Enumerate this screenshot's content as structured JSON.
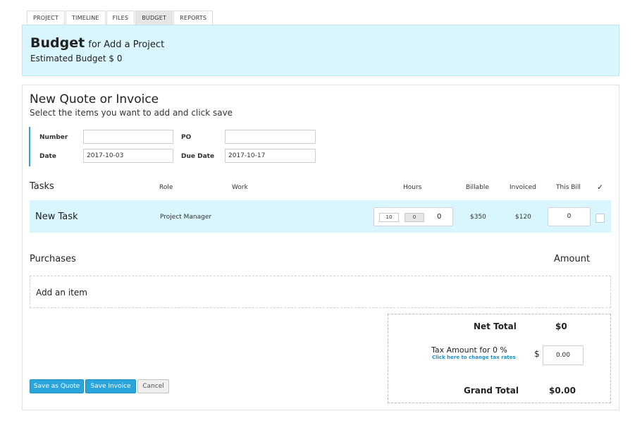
{
  "tabs": [
    "PROJECT",
    "TIMELINE",
    "FILES",
    "BUDGET",
    "REPORTS"
  ],
  "header": {
    "title_big": "Budget",
    "title_small": "for Add a Project",
    "estimated": "Estimated Budget $ 0"
  },
  "quote": {
    "title": "New Quote or Invoice",
    "subtitle": "Select the items you want to add and click save"
  },
  "form": {
    "number_label": "Number",
    "number_value": "",
    "po_label": "PO",
    "po_value": "",
    "date_label": "Date",
    "date_value": "2017-10-03",
    "due_label": "Due Date",
    "due_value": "2017-10-17"
  },
  "tasks": {
    "title": "Tasks",
    "columns": {
      "role": "Role",
      "work": "Work",
      "hours": "Hours",
      "billable": "Billable",
      "invoiced": "Invoiced",
      "this_bill": "This Bill",
      "check": "✓"
    },
    "rows": [
      {
        "name": "New Task",
        "role": "Project Manager",
        "hours_a": "10",
        "hours_b": "0",
        "hours_c": "0",
        "billable": "$350",
        "invoiced": "$120",
        "this_bill": "0"
      }
    ]
  },
  "purchases": {
    "title": "Purchases",
    "amount_label": "Amount",
    "add_item": "Add an item"
  },
  "totals": {
    "net_label": "Net Total",
    "net_value": "$0",
    "tax_label": "Tax Amount for 0 %",
    "tax_link": "Click here to change tax rates",
    "currency": "$",
    "tax_value": "0.00",
    "grand_label": "Grand Total",
    "grand_value": "$0.00"
  },
  "buttons": {
    "save_quote": "Save as Quote",
    "save_invoice": "Save Invoice",
    "cancel": "Cancel"
  },
  "colors": {
    "accent": "#2aa4dc",
    "highlight_bg": "#d9f5fd",
    "link": "#1d8fc4"
  }
}
